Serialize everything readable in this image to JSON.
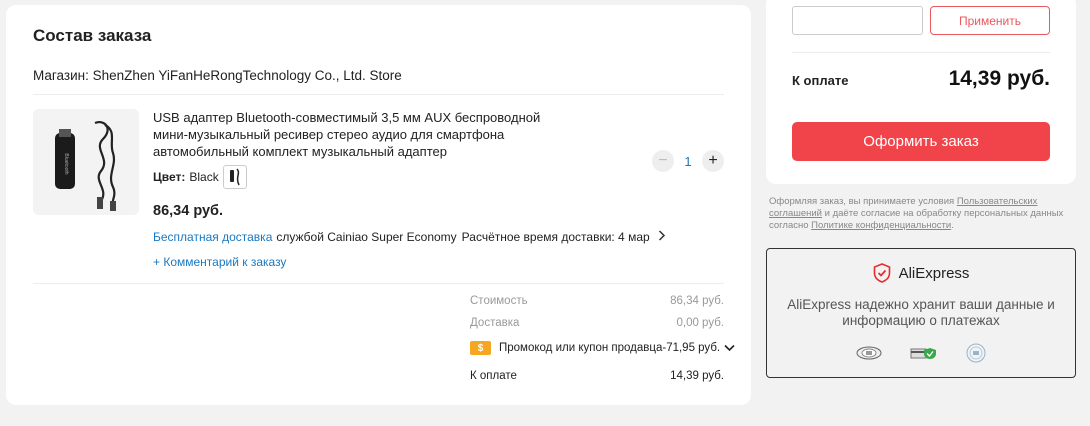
{
  "order": {
    "title": "Состав заказа",
    "store": "Магазин: ShenZhen YiFanHeRongTechnology Co., Ltd. Store",
    "product": {
      "name": "USB адаптер Bluetooth-совместимый 3,5 мм AUX беспроводной мини-музыкальный ресивер стерео аудио для смартфона автомобильный комплект музыкальный адаптер",
      "color_label": "Цвет:",
      "color_value": "Black",
      "price": "86,34 руб.",
      "free_shipping": "Бесплатная доставка",
      "carrier": "службой Cainiao Super Economy",
      "delivery_estimate": "Расчётное время доставки: 4 мар",
      "comment_link": "+ Комментарий к заказу",
      "quantity": "1",
      "minus_label": "−",
      "plus_label": "+"
    },
    "summary": {
      "cost_label": "Стоимость",
      "cost_value": "86,34 руб.",
      "delivery_label": "Доставка",
      "delivery_value": "0,00 руб.",
      "promo_icon_text": "$",
      "promo_text": "Промокод или купон продавца-71,95 руб.",
      "total_label": "К оплате",
      "total_value": "14,39 руб."
    }
  },
  "payment": {
    "coupon_placeholder": "",
    "apply_button": "Применить",
    "pay_label": "К оплате",
    "pay_amount": "14,39 руб.",
    "checkout_button": "Оформить заказ"
  },
  "terms": {
    "part1": "Оформляя заказ, вы принимаете условия ",
    "link1": "Пользовательских соглашений",
    "part2": " и даёте согласие на обработку персональных данных согласно ",
    "link2": "Политике конфиденциальности",
    "part3": "."
  },
  "security": {
    "brand": "AliExpress",
    "text": "AliExpress надежно хранит ваши данные и информацию о платежах"
  },
  "colors": {
    "accent_red": "#f0444a",
    "link_blue": "#1a78c2",
    "promo_orange": "#f5a623"
  }
}
